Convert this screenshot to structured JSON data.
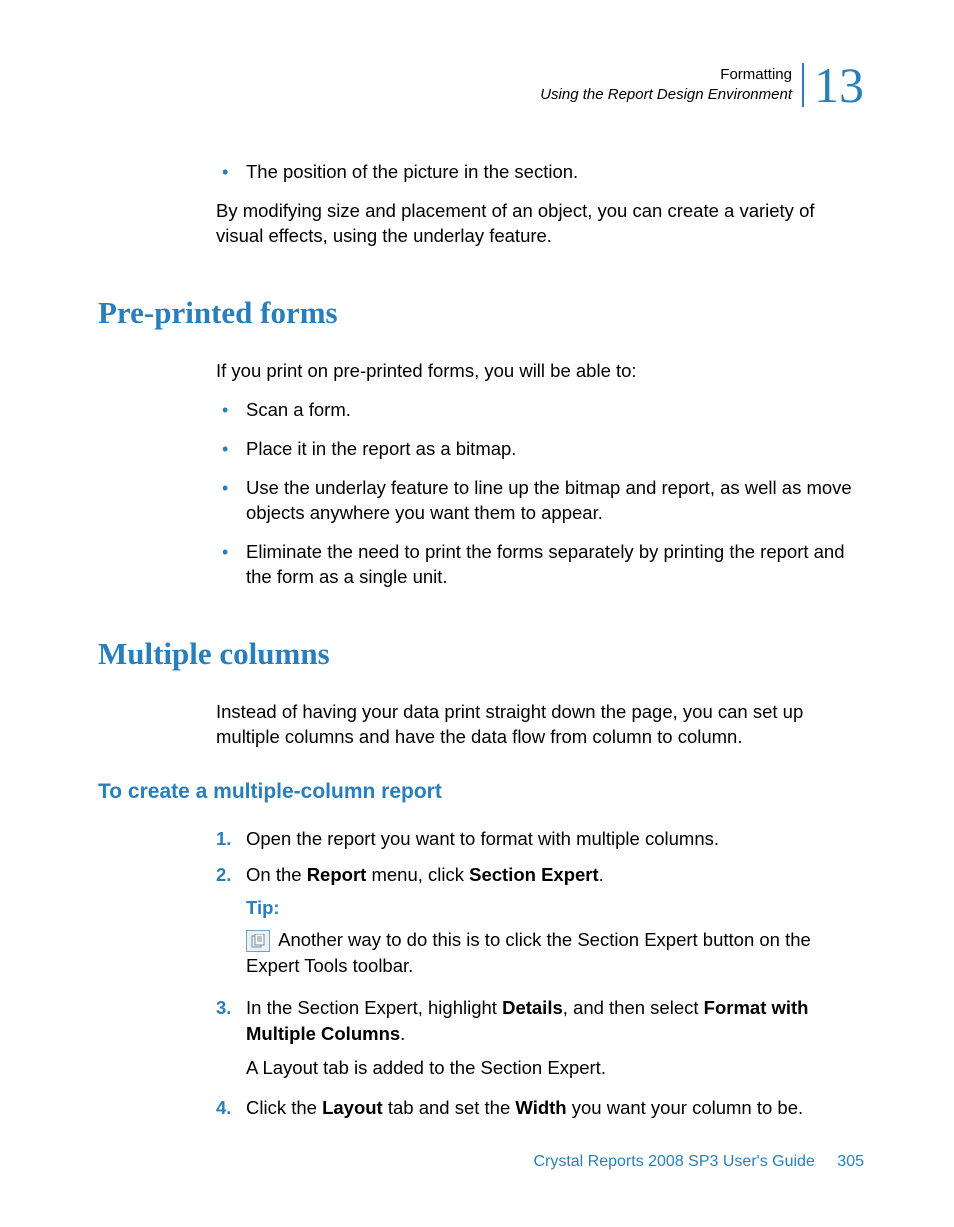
{
  "header": {
    "line1": "Formatting",
    "line2": "Using the Report Design Environment",
    "chapter": "13"
  },
  "intro_bullets": [
    "The position of the picture in the section."
  ],
  "intro_para": "By modifying size and placement of an object, you can create a variety of visual effects, using the underlay feature.",
  "section1": {
    "heading": "Pre-printed forms",
    "lead": "If you print on pre-printed forms, you will be able to:",
    "bullets": [
      "Scan a form.",
      "Place it in the report as a bitmap.",
      "Use the underlay feature to line up the bitmap and report, as well as move objects anywhere you want them to appear.",
      "Eliminate the need to print the forms separately by printing the report and the form as a single unit."
    ]
  },
  "section2": {
    "heading": "Multiple columns",
    "lead": "Instead of having your data print straight down the page, you can set up multiple columns and have the data flow from column to column.",
    "sub": "To create a multiple-column report",
    "steps": {
      "s1": "Open the report you want to format with multiple columns.",
      "s2_pre": "On the ",
      "s2_b1": "Report",
      "s2_mid": " menu, click ",
      "s2_b2": "Section Expert",
      "s2_post": ".",
      "tip_label": "Tip:",
      "tip_text": " Another way to do this is to click the Section Expert button on the Expert Tools toolbar.",
      "s3_pre": "In the Section Expert, highlight ",
      "s3_b1": "Details",
      "s3_mid": ", and then select ",
      "s3_b2": "Format with Multiple Columns",
      "s3_post": ".",
      "s3_after": "A Layout tab is added to the Section Expert.",
      "s4_pre": "Click the ",
      "s4_b1": "Layout",
      "s4_mid": " tab and set the ",
      "s4_b2": "Width",
      "s4_post": " you want your column to be."
    }
  },
  "footer": {
    "title": "Crystal Reports 2008 SP3 User's Guide",
    "page": "305"
  }
}
